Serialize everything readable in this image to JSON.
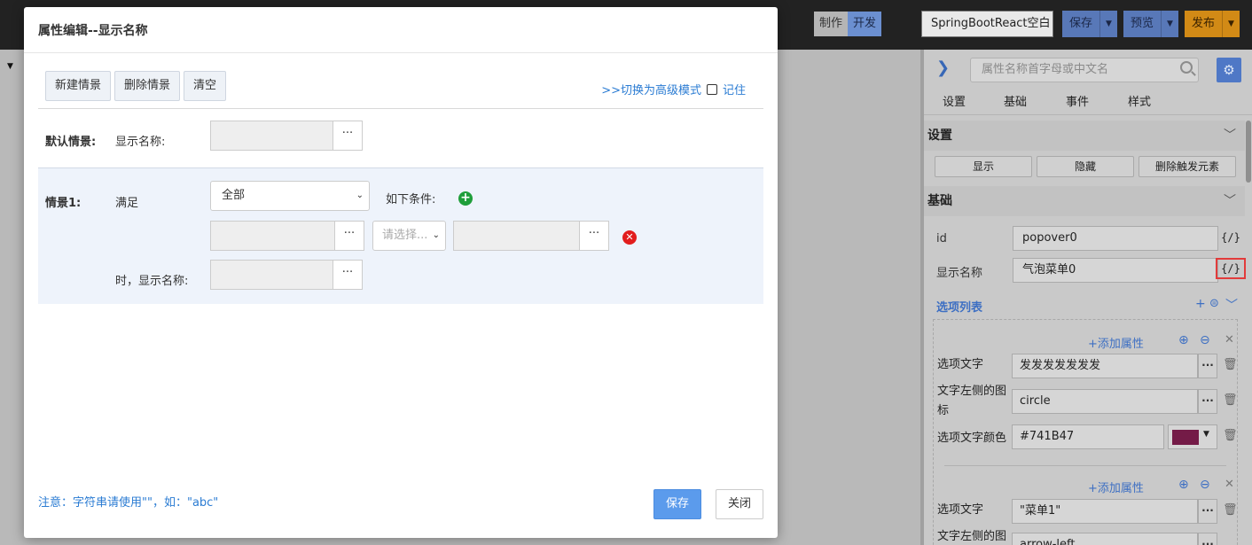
{
  "topbar": {
    "make_label": "制作",
    "dev_label": "开发",
    "project": "SpringBootReact空白",
    "save_label": "保存",
    "preview_label": "预览",
    "publish_label": "发布"
  },
  "right_panel": {
    "search_placeholder": "属性名称首字母或中文名",
    "tabs": [
      "设置",
      "基础",
      "事件",
      "样式"
    ],
    "settings_title": "设置",
    "actions": [
      "显示",
      "隐藏",
      "删除触发元素"
    ],
    "basic_title": "基础",
    "id_label": "id",
    "id_value": "popover0",
    "name_label": "显示名称",
    "name_value": "气泡菜单0",
    "code_icon": "{/}",
    "options_title": "选项列表",
    "add_attr_label": "+添加属性",
    "option1": {
      "text_label": "选项文字",
      "text_value": "发发发发发发发",
      "icon_label": "文字左侧的图标",
      "icon_value": "circle",
      "color_label": "选项文字颜色",
      "color_value": "#741B47"
    },
    "option2": {
      "text_label": "选项文字",
      "text_value": "\"菜单1\"",
      "icon_label": "文字左侧的图标",
      "icon_value": "arrow-left"
    }
  },
  "modal": {
    "title": "属性编辑--显示名称",
    "toolbar": [
      "新建情景",
      "删除情景",
      "清空"
    ],
    "advanced_link": ">>切换为高级模式",
    "remember_label": "记住",
    "default_scene_label": "默认情景:",
    "display_name_label": "显示名称:",
    "scene1_label": "情景1:",
    "satisfy_label": "满足",
    "match_select": "全部",
    "conditions_label": "如下条件:",
    "operator_placeholder": "请选择...",
    "then_label": "时，显示名称:",
    "ellipsis": "···",
    "note": "注意：字符串请使用\"\"，如：\"abc\"",
    "save_label": "保存",
    "close_label": "关闭"
  },
  "colors": {
    "accent_blue": "#5b9bec",
    "link_blue": "#2b7cd3",
    "add_green": "#1f9e3a",
    "remove_red": "#e21d1d",
    "option_color_swatch": "#741B47"
  }
}
